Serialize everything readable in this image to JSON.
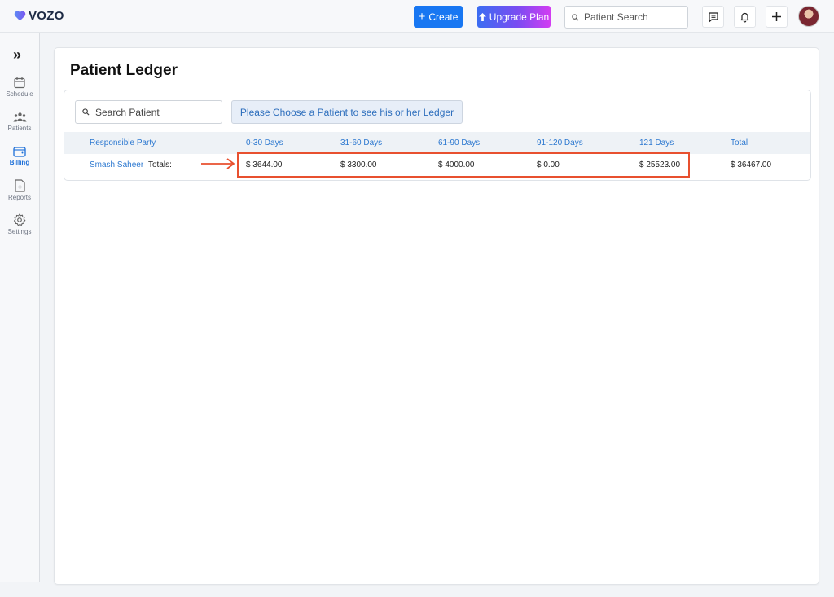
{
  "brand": {
    "name": "VOZO"
  },
  "header": {
    "create_label": "Create",
    "upgrade_label": "Upgrade Plan",
    "search_placeholder": "Patient Search"
  },
  "sidebar": {
    "items": [
      {
        "label": "Schedule",
        "icon": "calendar-icon"
      },
      {
        "label": "Patients",
        "icon": "users-icon"
      },
      {
        "label": "Billing",
        "icon": "wallet-icon",
        "active": true
      },
      {
        "label": "Reports",
        "icon": "report-icon"
      },
      {
        "label": "Settings",
        "icon": "gear-icon"
      }
    ]
  },
  "page": {
    "title": "Patient Ledger",
    "search_placeholder": "Search Patient",
    "choose_patient_label": "Please Choose a Patient to see his or her Ledger"
  },
  "table": {
    "columns": [
      "Responsible Party",
      "0-30 Days",
      "31-60 Days",
      "61-90 Days",
      "91-120 Days",
      "121 Days",
      "Total"
    ],
    "row": {
      "party": "Smash Saheer",
      "totals_label": "Totals:",
      "d0_30": "$ 3644.00",
      "d31_60": "$ 3300.00",
      "d61_90": "$ 4000.00",
      "d91_120": "$ 0.00",
      "d121": "$ 25523.00",
      "total": "$ 36467.00"
    }
  },
  "colors": {
    "primary": "#1877f2",
    "link": "#2c78d0",
    "highlight": "#e8502f"
  }
}
